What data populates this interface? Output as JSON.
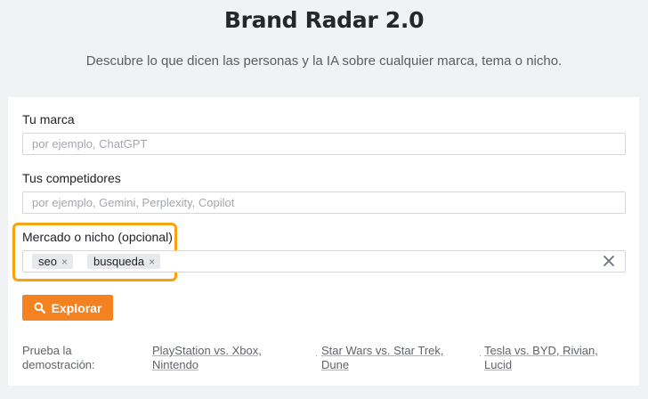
{
  "header": {
    "title": "Brand Radar 2.0",
    "subtitle": "Descubre lo que dicen las personas y la IA sobre cualquier marca, tema o nicho."
  },
  "form": {
    "brand": {
      "label": "Tu marca",
      "placeholder": "por ejemplo, ChatGPT",
      "value": ""
    },
    "competitors": {
      "label": "Tus competidores",
      "placeholder": "por ejemplo, Gemini, Perplexity, Copilot",
      "value": ""
    },
    "market": {
      "label": "Mercado o nicho (opcional)",
      "tags": [
        "seo",
        "busqueda"
      ],
      "tag_remove_glyph": "×"
    },
    "explore_label": "Explorar"
  },
  "demo": {
    "label": "Prueba la demostración:",
    "separator": "·",
    "links": [
      "PlayStation vs. Xbox, Nintendo",
      "Star Wars vs. Star Trek, Dune",
      "Tesla vs. BYD, Rivian, Lucid"
    ]
  },
  "colors": {
    "background": "#f1f2f4",
    "accent": "#f58220",
    "highlight": "#f8a20f"
  },
  "icons": {
    "explore": "search-icon",
    "clear": "close-icon"
  }
}
